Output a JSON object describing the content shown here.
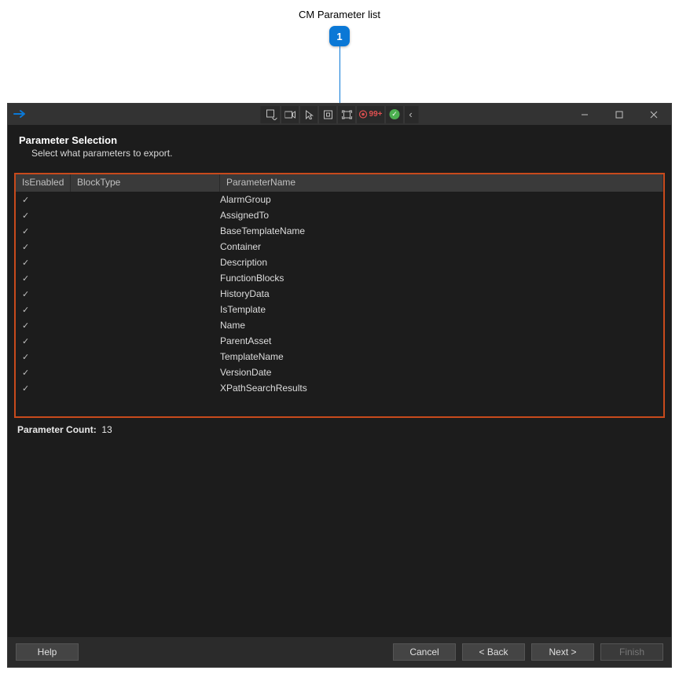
{
  "annotation": {
    "label": "CM Parameter list",
    "bubble_number": "1"
  },
  "titlebar": {
    "badge_text": "99+",
    "nav_arrow_glyph": "‹"
  },
  "header": {
    "title": "Parameter Selection",
    "subtitle": "Select what parameters to export."
  },
  "columns": {
    "c1": "IsEnabled",
    "c2": "BlockType",
    "c3": "ParameterName"
  },
  "rows": [
    {
      "enabled": true,
      "block": "",
      "param": "AlarmGroup"
    },
    {
      "enabled": true,
      "block": "",
      "param": "AssignedTo"
    },
    {
      "enabled": true,
      "block": "",
      "param": "BaseTemplateName"
    },
    {
      "enabled": true,
      "block": "",
      "param": "Container"
    },
    {
      "enabled": true,
      "block": "",
      "param": "Description"
    },
    {
      "enabled": true,
      "block": "",
      "param": "FunctionBlocks"
    },
    {
      "enabled": true,
      "block": "",
      "param": "HistoryData"
    },
    {
      "enabled": true,
      "block": "",
      "param": "IsTemplate"
    },
    {
      "enabled": true,
      "block": "",
      "param": "Name"
    },
    {
      "enabled": true,
      "block": "",
      "param": "ParentAsset"
    },
    {
      "enabled": true,
      "block": "",
      "param": "TemplateName"
    },
    {
      "enabled": true,
      "block": "",
      "param": "VersionDate"
    },
    {
      "enabled": true,
      "block": "",
      "param": "XPathSearchResults"
    }
  ],
  "count": {
    "label": "Parameter Count:",
    "value": "13"
  },
  "footer": {
    "help": "Help",
    "cancel": "Cancel",
    "back": "< Back",
    "next": "Next >",
    "finish": "Finish"
  },
  "icons": {
    "check": "✓"
  }
}
